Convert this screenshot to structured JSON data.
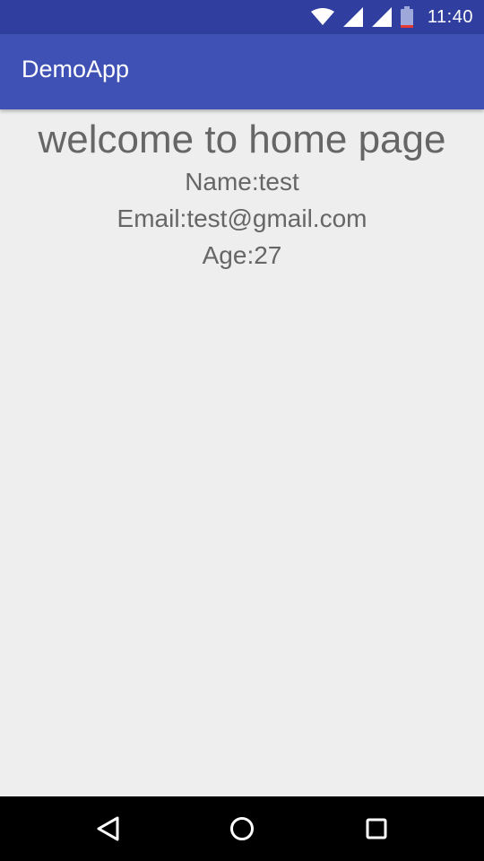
{
  "status_bar": {
    "time": "11:40",
    "icons": [
      "wifi-icon",
      "signal-icon",
      "signal-icon",
      "battery-icon"
    ]
  },
  "app_bar": {
    "title": "DemoApp",
    "color": "#3f51b5",
    "status_color": "#303f9f"
  },
  "main": {
    "heading": "welcome to home page",
    "name_line": "Name:test",
    "email_line": "Email:test@gmail.com",
    "age_line": "Age:27"
  },
  "nav_bar": {
    "buttons": [
      "back-icon",
      "home-icon",
      "recents-icon"
    ]
  }
}
